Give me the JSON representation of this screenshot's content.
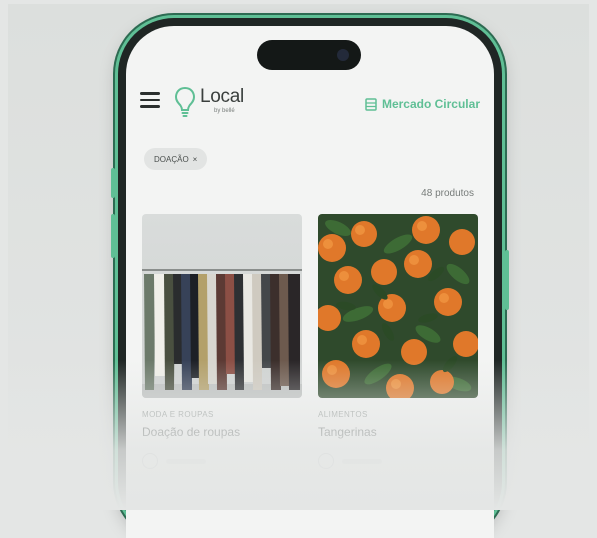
{
  "header": {
    "logo_name": "Local",
    "logo_sub": "by bellé",
    "market_label": "Mercado Circular"
  },
  "filter": {
    "chip_label": "DOAÇÃO",
    "remove_symbol": "×"
  },
  "results": {
    "count_label": "48 produtos"
  },
  "products": [
    {
      "category": "MODA E ROUPAS",
      "title": "Doação de roupas"
    },
    {
      "category": "ALIMENTOS",
      "title": "Tangerinas"
    }
  ],
  "colors": {
    "accent": "#5fbf95",
    "frame": "#1f2624",
    "screen": "#f3f4f3"
  },
  "icons": [
    "menu-icon",
    "lightbulb-icon",
    "storefront-icon",
    "close-icon"
  ]
}
